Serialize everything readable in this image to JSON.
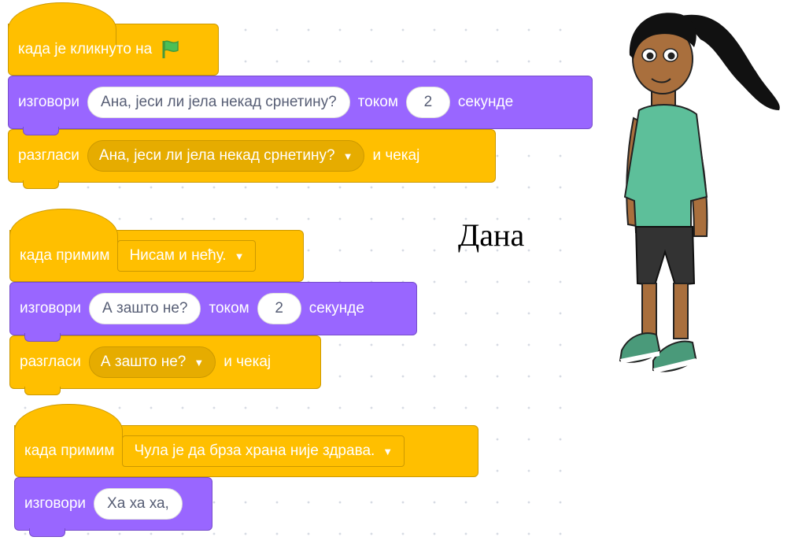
{
  "script1": {
    "hat_label": "када је кликнуто на",
    "say_label": "изговори",
    "say_text": "Ана, јеси ли јела некад срнетину?",
    "for_label": "током",
    "seconds_value": "2",
    "seconds_label": "секунде",
    "broadcast_label": "разгласи",
    "broadcast_message": "Ана, јеси ли јела некад срнетину?",
    "wait_label": "и чекај"
  },
  "script2": {
    "hat_label": "када примим",
    "hat_message": "Нисам и нећу.",
    "say_label": "изговори",
    "say_text": "А зашто не?",
    "for_label": "током",
    "seconds_value": "2",
    "seconds_label": "секунде",
    "broadcast_label": "разгласи",
    "broadcast_message": "А зашто не?",
    "wait_label": "и чекај"
  },
  "script3": {
    "hat_label": "када примим",
    "hat_message": "Чула је да брза храна није здрава.",
    "say_label": "изговори",
    "say_text": "Ха ха ха,"
  },
  "sprite": {
    "name": "Дана"
  },
  "icons": {
    "flag": "green-flag-icon",
    "dropdown": "caret-down-icon"
  },
  "colors": {
    "events": "#ffbf00",
    "looks": "#9966ff"
  }
}
